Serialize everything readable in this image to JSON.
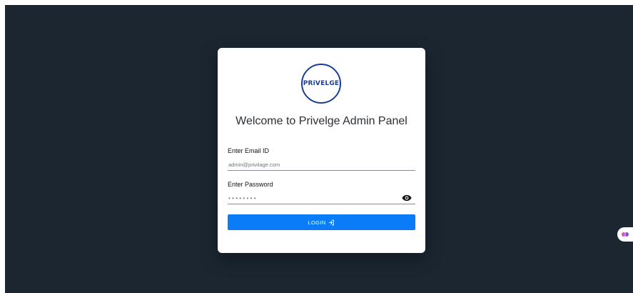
{
  "app": {
    "background_color": "#1b2631",
    "accent_color": "#0a7cf8",
    "brand_color": "#1c3f95"
  },
  "logo": {
    "text": "PRiVELGE",
    "icon": "privelge-logo"
  },
  "login": {
    "title": "Welcome to Privelge Admin Panel",
    "email_label": "Enter Email ID",
    "email_placeholder": "admin@privilage.com",
    "password_label": "Enter Password",
    "password_mask": "••••••••",
    "password_toggle_icon": "eye-icon",
    "button_label": "LOGIN",
    "button_icon": "login-arrow-icon"
  },
  "side_widget": {
    "icon": "brain-icon"
  }
}
